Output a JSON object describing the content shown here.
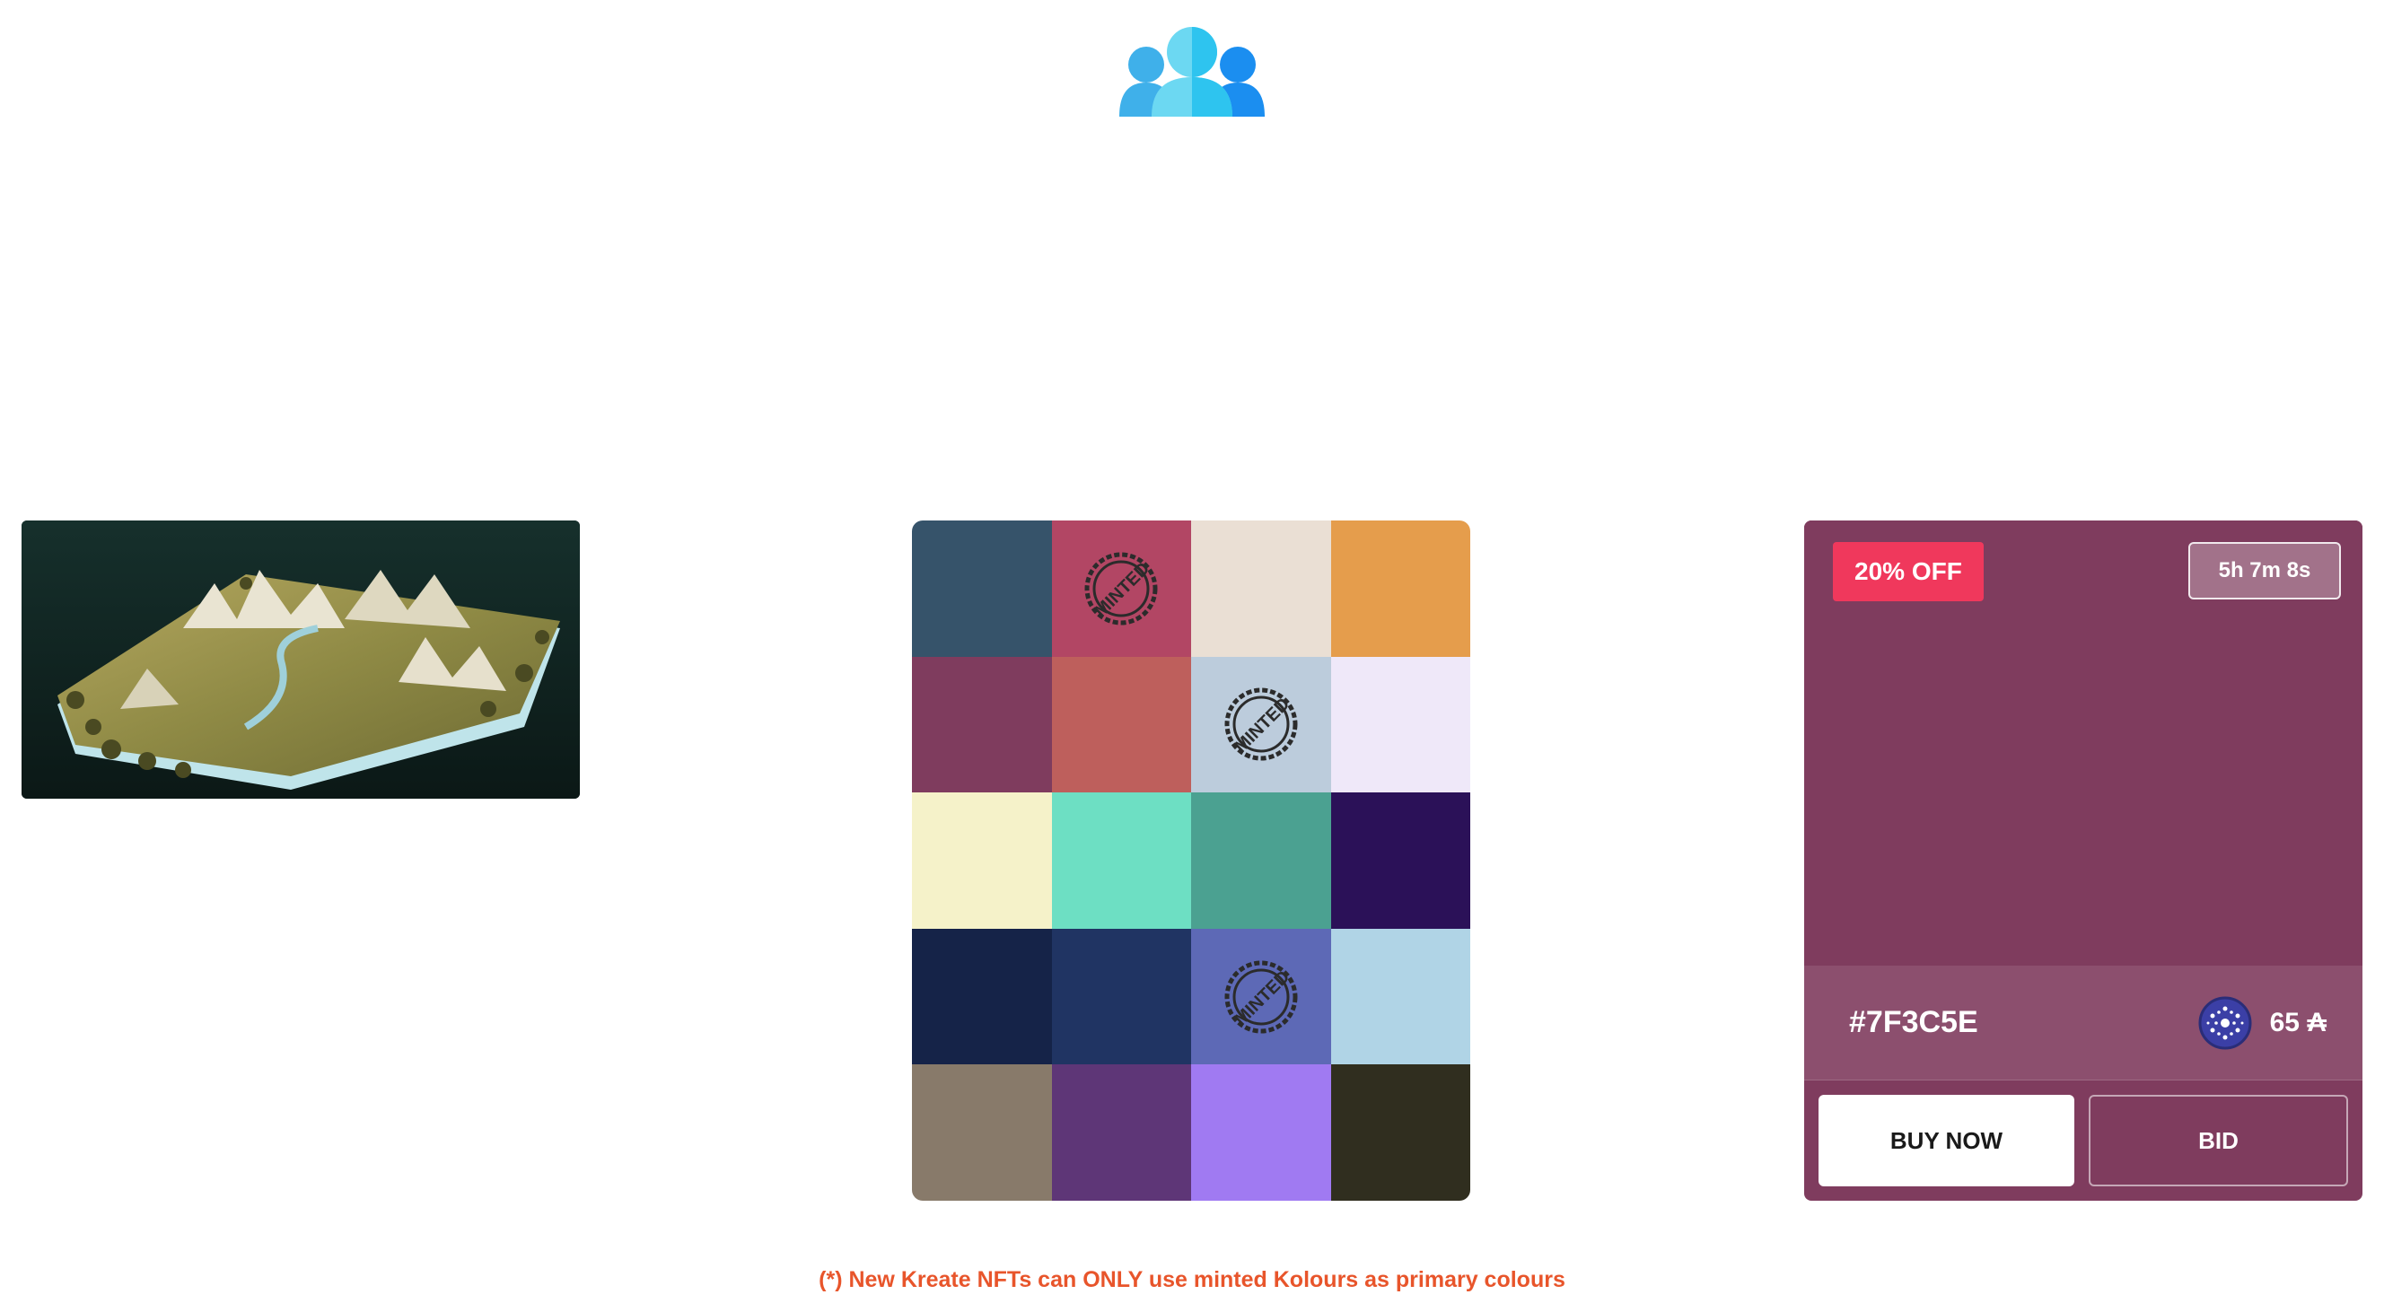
{
  "header": {
    "logo_icon": "users-group-icon"
  },
  "palette": {
    "stamp_text": "MINTED",
    "swatches": [
      {
        "color": "#36536A",
        "minted": false
      },
      {
        "color": "#B24664",
        "minted": true
      },
      {
        "color": "#EADFD4",
        "minted": false
      },
      {
        "color": "#E59D4C",
        "minted": false
      },
      {
        "color": "#7F3C5E",
        "minted": false
      },
      {
        "color": "#BE5F5C",
        "minted": false
      },
      {
        "color": "#BCCCDC",
        "minted": true
      },
      {
        "color": "#EFE8F9",
        "minted": false
      },
      {
        "color": "#F5F2C9",
        "minted": false
      },
      {
        "color": "#6DDFC3",
        "minted": false
      },
      {
        "color": "#4BA191",
        "minted": false
      },
      {
        "color": "#2B1158",
        "minted": false
      },
      {
        "color": "#152348",
        "minted": false
      },
      {
        "color": "#203463",
        "minted": false
      },
      {
        "color": "#5D69B6",
        "minted": true
      },
      {
        "color": "#B0D4E6",
        "minted": false
      },
      {
        "color": "#887A6A",
        "minted": false
      },
      {
        "color": "#5E3677",
        "minted": false
      },
      {
        "color": "#A07AF2",
        "minted": false
      },
      {
        "color": "#302E1F",
        "minted": false
      }
    ]
  },
  "card": {
    "color": "#7F3C5E",
    "discount": "20% OFF",
    "timer": "5h 7m 8s",
    "hex_label": "#7F3C5E",
    "price": "65 ₳",
    "currency_icon": "cardano-ada-icon",
    "buy_label": "BUY NOW",
    "bid_label": "BID"
  },
  "footer": {
    "note": "(*) New Kreate NFTs can ONLY use minted Kolours as primary colours",
    "note_color": "#E8552B"
  }
}
